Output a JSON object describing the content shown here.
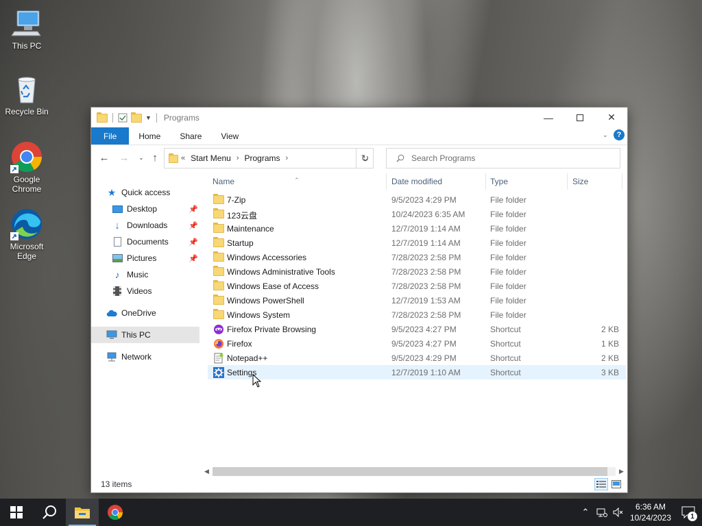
{
  "desktop": {
    "icons": [
      {
        "label": "This PC"
      },
      {
        "label": "Recycle Bin"
      },
      {
        "label": "Google Chrome"
      },
      {
        "label": "Microsoft Edge"
      }
    ]
  },
  "window": {
    "title": "Programs",
    "ribbon_tabs": [
      "File",
      "Home",
      "Share",
      "View"
    ],
    "help_label": "?",
    "address": {
      "prefix": "«",
      "crumbs": [
        "Start Menu",
        "Programs"
      ]
    },
    "search": {
      "placeholder": "Search Programs"
    },
    "nav": {
      "quick_access": "Quick access",
      "pinned": [
        {
          "label": "Desktop",
          "pinned": true
        },
        {
          "label": "Downloads",
          "pinned": true
        },
        {
          "label": "Documents",
          "pinned": true
        },
        {
          "label": "Pictures",
          "pinned": true
        },
        {
          "label": "Music",
          "pinned": false
        },
        {
          "label": "Videos",
          "pinned": false
        }
      ],
      "onedrive": "OneDrive",
      "this_pc": "This PC",
      "network": "Network"
    },
    "columns": {
      "name": "Name",
      "date": "Date modified",
      "type": "Type",
      "size": "Size"
    },
    "files": [
      {
        "name": "7-Zip",
        "date": "9/5/2023 4:29 PM",
        "type": "File folder",
        "size": "",
        "icon": "folder-icon"
      },
      {
        "name": "123云盘",
        "date": "10/24/2023 6:35 AM",
        "type": "File folder",
        "size": "",
        "icon": "folder-icon"
      },
      {
        "name": "Maintenance",
        "date": "12/7/2019 1:14 AM",
        "type": "File folder",
        "size": "",
        "icon": "folder-icon"
      },
      {
        "name": "Startup",
        "date": "12/7/2019 1:14 AM",
        "type": "File folder",
        "size": "",
        "icon": "folder-icon"
      },
      {
        "name": "Windows Accessories",
        "date": "7/28/2023 2:58 PM",
        "type": "File folder",
        "size": "",
        "icon": "folder-icon"
      },
      {
        "name": "Windows Administrative Tools",
        "date": "7/28/2023 2:58 PM",
        "type": "File folder",
        "size": "",
        "icon": "folder-icon"
      },
      {
        "name": "Windows Ease of Access",
        "date": "7/28/2023 2:58 PM",
        "type": "File folder",
        "size": "",
        "icon": "folder-icon"
      },
      {
        "name": "Windows PowerShell",
        "date": "12/7/2019 1:53 AM",
        "type": "File folder",
        "size": "",
        "icon": "folder-icon"
      },
      {
        "name": "Windows System",
        "date": "7/28/2023 2:58 PM",
        "type": "File folder",
        "size": "",
        "icon": "folder-icon"
      },
      {
        "name": "Firefox Private Browsing",
        "date": "9/5/2023 4:27 PM",
        "type": "Shortcut",
        "size": "2 KB",
        "icon": "firefox-private-icon"
      },
      {
        "name": "Firefox",
        "date": "9/5/2023 4:27 PM",
        "type": "Shortcut",
        "size": "1 KB",
        "icon": "firefox-icon"
      },
      {
        "name": "Notepad++",
        "date": "9/5/2023 4:29 PM",
        "type": "Shortcut",
        "size": "2 KB",
        "icon": "notepadpp-icon"
      },
      {
        "name": "Settings",
        "date": "12/7/2019 1:10 AM",
        "type": "Shortcut",
        "size": "3 KB",
        "icon": "settings-icon"
      }
    ],
    "selected_index": 12,
    "status": "13 items"
  },
  "taskbar": {
    "time": "6:36 AM",
    "date": "10/24/2023",
    "notification_count": "1",
    "accent": "#76b9ed"
  }
}
